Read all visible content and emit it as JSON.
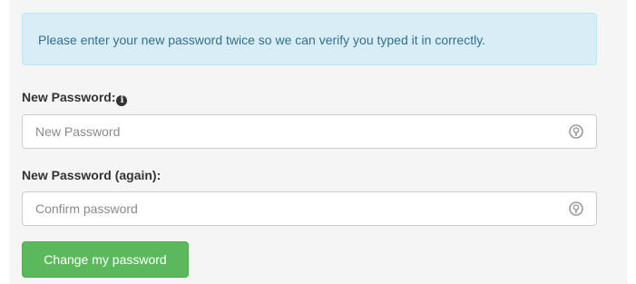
{
  "alert": {
    "message": "Please enter your new password twice so we can verify you typed it in correctly."
  },
  "new_password": {
    "label": "New Password:",
    "info_icon": "info-circle-icon",
    "placeholder": "New Password",
    "value": "",
    "field_icon": "password-manager-icon"
  },
  "confirm_password": {
    "label": "New Password (again):",
    "placeholder": "Confirm password",
    "value": "",
    "field_icon": "password-manager-icon"
  },
  "submit": {
    "label": "Change my password"
  },
  "colors": {
    "alert_bg": "#d9edf7",
    "alert_text": "#31708f",
    "button_bg": "#5cb85c",
    "panel_bg": "#f5f5f5"
  }
}
